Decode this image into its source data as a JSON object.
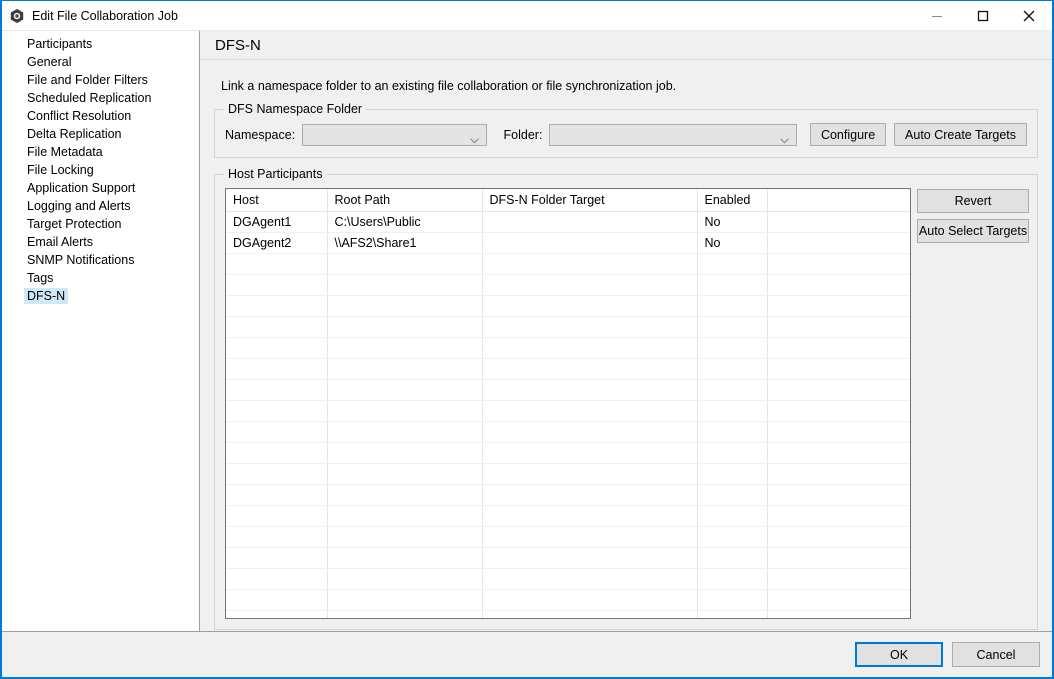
{
  "window": {
    "title": "Edit File Collaboration Job",
    "app_icon": "hexagon-eye-icon",
    "controls": {
      "minimize": "minimize-icon",
      "maximize": "maximize-icon",
      "close": "close-icon"
    },
    "accent_color": "#0078d7"
  },
  "sidebar": {
    "items": [
      {
        "label": "Participants",
        "selected": false
      },
      {
        "label": "General",
        "selected": false
      },
      {
        "label": "File and Folder Filters",
        "selected": false
      },
      {
        "label": "Scheduled Replication",
        "selected": false
      },
      {
        "label": "Conflict Resolution",
        "selected": false
      },
      {
        "label": "Delta Replication",
        "selected": false
      },
      {
        "label": "File Metadata",
        "selected": false
      },
      {
        "label": "File Locking",
        "selected": false
      },
      {
        "label": "Application Support",
        "selected": false
      },
      {
        "label": "Logging and Alerts",
        "selected": false
      },
      {
        "label": "Target Protection",
        "selected": false
      },
      {
        "label": "Email Alerts",
        "selected": false
      },
      {
        "label": "SNMP Notifications",
        "selected": false
      },
      {
        "label": "Tags",
        "selected": false
      },
      {
        "label": "DFS-N",
        "selected": true
      }
    ],
    "selection_color": "#cde8f7"
  },
  "panel": {
    "header_title": "DFS-N",
    "intro": "Link a namespace folder to an existing file collaboration or file synchronization job.",
    "namespace_group": {
      "legend": "DFS Namespace Folder",
      "namespace_label": "Namespace:",
      "namespace_value": "",
      "namespace_placeholder": "",
      "folder_label": "Folder:",
      "folder_value": "",
      "folder_placeholder": "",
      "configure_label": "Configure",
      "auto_create_targets_label": "Auto Create Targets"
    },
    "host_group": {
      "legend": "Host Participants",
      "columns": [
        "Host",
        "Root Path",
        "DFS-N Folder Target",
        "Enabled",
        ""
      ],
      "rows": [
        [
          "DGAgent1",
          "C:\\Users\\Public",
          "",
          "No",
          ""
        ],
        [
          "DGAgent2",
          "\\\\AFS2\\Share1",
          "",
          "No",
          ""
        ]
      ],
      "empty_row_count": 19,
      "revert_label": "Revert",
      "auto_select_targets_label": "Auto Select Targets"
    }
  },
  "footer": {
    "ok_label": "OK",
    "cancel_label": "Cancel"
  }
}
